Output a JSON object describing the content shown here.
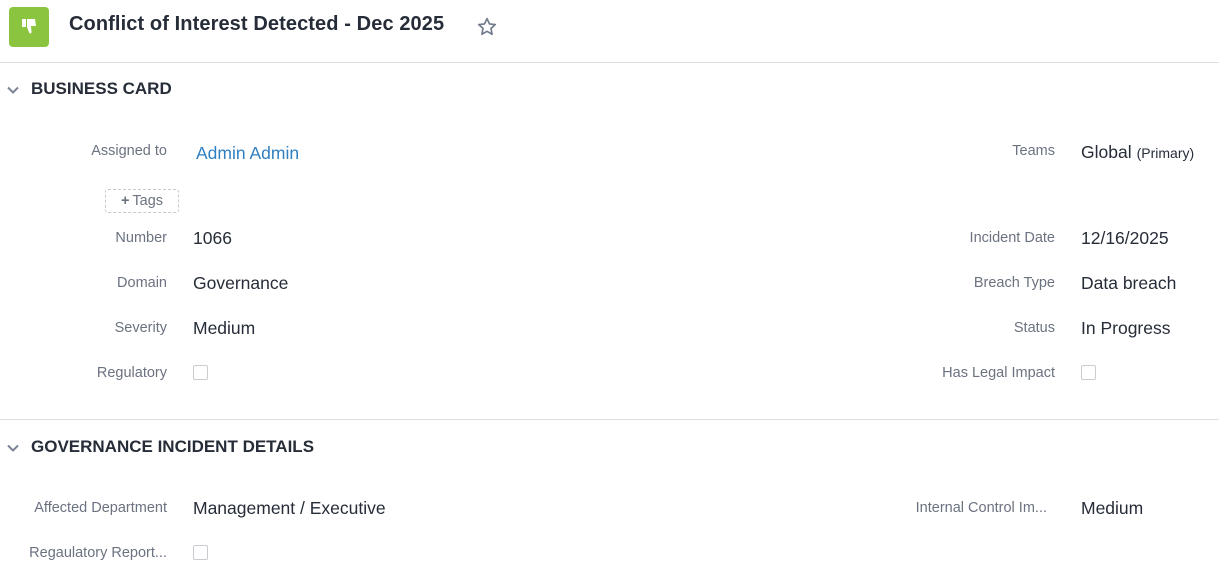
{
  "header": {
    "title": "Conflict of Interest Detected - Dec 2025",
    "app_icon": "thumbs-down-icon",
    "accent_color": "#8bc53f"
  },
  "business_card": {
    "section_title": "BUSINESS CARD",
    "assigned_to_label": "Assigned to",
    "assigned_to_value": "Admin Admin",
    "tags_label": "Tags",
    "teams_label": "Teams",
    "teams_value": "Global",
    "teams_suffix": "(Primary)",
    "number_label": "Number",
    "number_value": "1066",
    "incident_date_label": "Incident Date",
    "incident_date_value": "12/16/2025",
    "domain_label": "Domain",
    "domain_value": "Governance",
    "breach_type_label": "Breach Type",
    "breach_type_value": "Data breach",
    "severity_label": "Severity",
    "severity_value": "Medium",
    "status_label": "Status",
    "status_value": "In Progress",
    "regulatory_label": "Regulatory",
    "regulatory_checked": false,
    "legal_impact_label": "Has Legal Impact",
    "legal_impact_checked": false
  },
  "governance_details": {
    "section_title": "GOVERNANCE INCIDENT DETAILS",
    "affected_department_label": "Affected Department",
    "affected_department_value": "Management / Executive",
    "internal_control_label": "Internal Control Im...",
    "internal_control_value": "Medium",
    "regulatory_report_label": "Regaulatory Report...",
    "regulatory_report_checked": false
  }
}
